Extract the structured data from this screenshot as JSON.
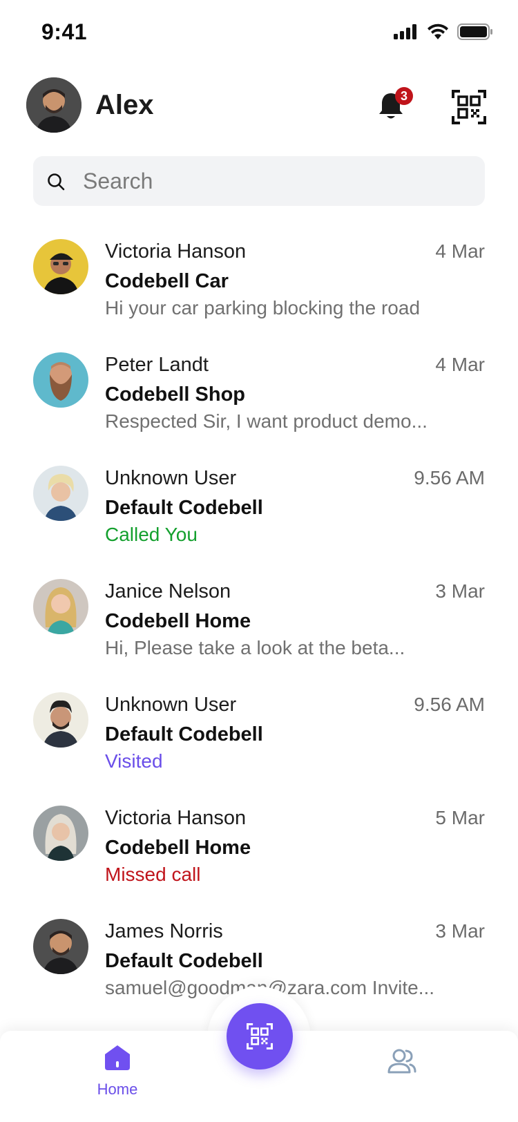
{
  "status_bar": {
    "time": "9:41"
  },
  "header": {
    "user_name": "Alex",
    "notification_count": "3"
  },
  "search": {
    "placeholder": "Search"
  },
  "conversations": [
    {
      "name": "Victoria Hanson",
      "time": "4 Mar",
      "title": "Codebell Car",
      "preview": "Hi your car  parking blocking the road",
      "preview_color": "#707070"
    },
    {
      "name": "Peter Landt",
      "time": "4 Mar",
      "title": "Codebell Shop",
      "preview": "Respected Sir, I want product demo...",
      "preview_color": "#707070"
    },
    {
      "name": "Unknown User",
      "time": "9.56 AM",
      "title": "Default Codebell",
      "preview": "Called You",
      "preview_color": "#14a02e"
    },
    {
      "name": "Janice Nelson",
      "time": "3 Mar",
      "title": "Codebell Home",
      "preview": "Hi, Please take a look at the beta...",
      "preview_color": "#707070"
    },
    {
      "name": "Unknown User",
      "time": "9.56 AM",
      "title": "Default Codebell",
      "preview": "Visited",
      "preview_color": "#6a4ee9"
    },
    {
      "name": "Victoria Hanson",
      "time": "5 Mar",
      "title": "Codebell Home",
      "preview": "Missed call",
      "preview_color": "#c0141b"
    },
    {
      "name": "James Norris",
      "time": "3 Mar",
      "title": "Default Codebell",
      "preview": "samuel@goodman@zara.com Invite...",
      "preview_color": "#707070"
    }
  ],
  "bottom_nav": {
    "home_label": "Home"
  },
  "colors": {
    "accent": "#7050f0",
    "badge": "#c0141b"
  }
}
